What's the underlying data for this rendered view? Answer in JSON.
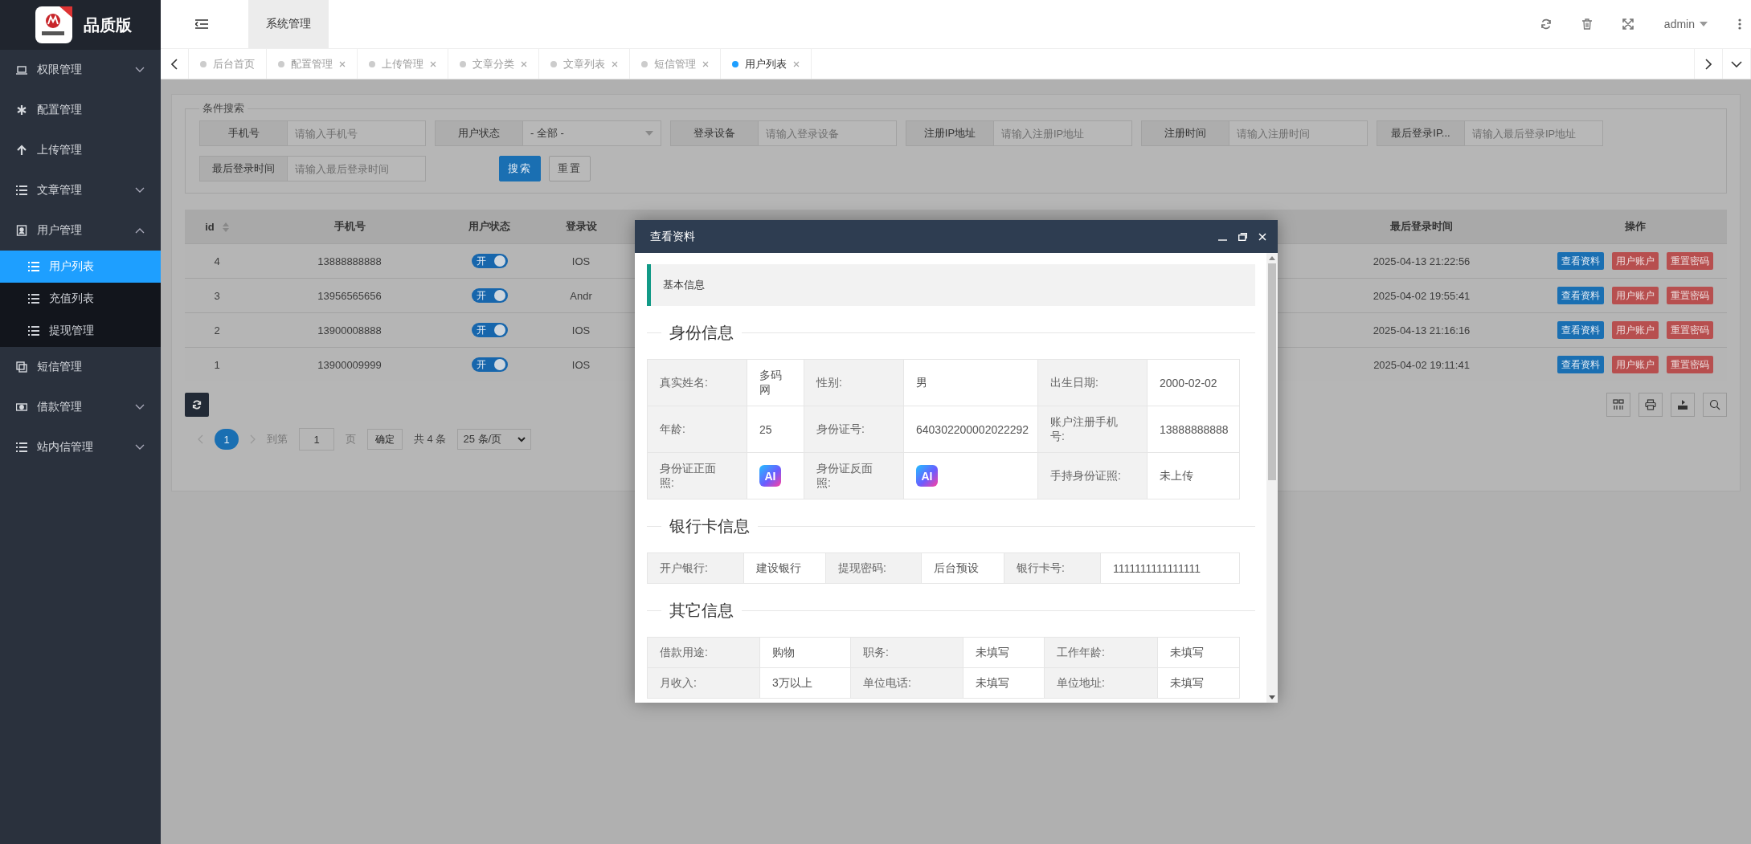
{
  "sidebar": {
    "brand": "品质版",
    "menu": [
      {
        "label": "权限管理",
        "expanded": false
      },
      {
        "label": "配置管理"
      },
      {
        "label": "上传管理"
      },
      {
        "label": "文章管理",
        "expanded": false
      },
      {
        "label": "用户管理",
        "expanded": true,
        "children": [
          {
            "label": "用户列表",
            "selected": true
          },
          {
            "label": "充值列表",
            "selected": false
          },
          {
            "label": "提现管理",
            "selected": false
          }
        ]
      },
      {
        "label": "短信管理"
      },
      {
        "label": "借款管理",
        "expanded": false
      },
      {
        "label": "站内信管理",
        "expanded": false
      }
    ]
  },
  "topbar": {
    "module_tab": "系统管理",
    "user": "admin"
  },
  "tabs": [
    {
      "label": "后台首页",
      "closable": false,
      "selected": false
    },
    {
      "label": "配置管理",
      "closable": true,
      "selected": false
    },
    {
      "label": "上传管理",
      "closable": true,
      "selected": false
    },
    {
      "label": "文章分类",
      "closable": true,
      "selected": false
    },
    {
      "label": "文章列表",
      "closable": true,
      "selected": false
    },
    {
      "label": "短信管理",
      "closable": true,
      "selected": false
    },
    {
      "label": "用户列表",
      "closable": true,
      "selected": true
    }
  ],
  "search": {
    "legend": "条件搜索",
    "fields": [
      {
        "label": "手机号",
        "kind": "input",
        "placeholder": "请输入手机号"
      },
      {
        "label": "用户状态",
        "kind": "select",
        "value": "- 全部 -"
      },
      {
        "label": "登录设备",
        "kind": "input",
        "placeholder": "请输入登录设备"
      },
      {
        "label": "注册IP地址",
        "kind": "input",
        "placeholder": "请输入注册IP地址"
      },
      {
        "label": "注册时间",
        "kind": "input",
        "placeholder": "请输入注册时间"
      },
      {
        "label": "最后登录IP...",
        "kind": "input",
        "placeholder": "请输入最后登录IP地址"
      },
      {
        "label": "最后登录时间",
        "kind": "input",
        "placeholder": "请输入最后登录时间"
      }
    ],
    "buttons": [
      {
        "label": "搜索",
        "kind": "primary"
      },
      {
        "label": "重置",
        "kind": "default"
      }
    ]
  },
  "table": {
    "columns": [
      {
        "label": "id",
        "sortable": true
      },
      {
        "label": "手机号",
        "sortable": false
      },
      {
        "label": "用户状态",
        "sortable": false
      },
      {
        "label": "登录设",
        "sortable": false
      },
      {
        "label": "最后登录时间",
        "sortable": false
      },
      {
        "label": "操作",
        "sortable": false
      }
    ],
    "rows": [
      {
        "id": "4",
        "phone": "13888888888",
        "status": {
          "label": "开",
          "on": true
        },
        "device": "IOS",
        "last_login": "2025-04-13 21:22:56",
        "actions": [
          {
            "label": "查看资料",
            "kind": "primary"
          },
          {
            "label": "用户账户",
            "kind": "danger"
          },
          {
            "label": "重置密码",
            "kind": "danger"
          }
        ]
      },
      {
        "id": "3",
        "phone": "13956565656",
        "status": {
          "label": "开",
          "on": true
        },
        "device": "Andr",
        "last_login": "2025-04-02 19:55:41",
        "actions": [
          {
            "label": "查看资料",
            "kind": "primary"
          },
          {
            "label": "用户账户",
            "kind": "danger"
          },
          {
            "label": "重置密码",
            "kind": "danger"
          }
        ]
      },
      {
        "id": "2",
        "phone": "13900008888",
        "status": {
          "label": "开",
          "on": true
        },
        "device": "IOS",
        "last_login": "2025-04-13 21:16:16",
        "actions": [
          {
            "label": "查看资料",
            "kind": "primary"
          },
          {
            "label": "用户账户",
            "kind": "danger"
          },
          {
            "label": "重置密码",
            "kind": "danger"
          }
        ]
      },
      {
        "id": "1",
        "phone": "13900009999",
        "status": {
          "label": "开",
          "on": true
        },
        "device": "IOS",
        "last_login": "2025-04-02 19:11:41",
        "actions": [
          {
            "label": "查看资料",
            "kind": "primary"
          },
          {
            "label": "用户账户",
            "kind": "danger"
          },
          {
            "label": "重置密码",
            "kind": "danger"
          }
        ]
      }
    ]
  },
  "pagination": {
    "pages": [
      {
        "label": "1",
        "selected": true
      }
    ],
    "goto_label": "到第",
    "page_input": "1",
    "page_unit": "页",
    "confirm": "确定",
    "total": "共 4 条",
    "page_size": "25 条/页"
  },
  "modal": {
    "title": "查看资料",
    "note": "基本信息",
    "sections": [
      {
        "title": "身份信息",
        "rows": [
          [
            {
              "label": "真实姓名:",
              "value": "多码网",
              "kind": "text"
            },
            {
              "label": "性别:",
              "value": "男",
              "kind": "text"
            },
            {
              "label": "出生日期:",
              "value": "2000-02-02",
              "kind": "text"
            }
          ],
          [
            {
              "label": "年龄:",
              "value": "25",
              "kind": "text"
            },
            {
              "label": "身份证号:",
              "value": "640302200002022292",
              "kind": "text"
            },
            {
              "label": "账户注册手机号:",
              "value": "13888888888",
              "kind": "text"
            }
          ],
          [
            {
              "label": "身份证正面照:",
              "value": "AI",
              "kind": "image"
            },
            {
              "label": "身份证反面照:",
              "value": "AI",
              "kind": "image"
            },
            {
              "label": "手持身份证照:",
              "value": "未上传",
              "kind": "text"
            }
          ]
        ]
      },
      {
        "title": "银行卡信息",
        "rows": [
          [
            {
              "label": "开户银行:",
              "value": "建设银行",
              "kind": "text"
            },
            {
              "label": "提现密码:",
              "value": "后台预设",
              "kind": "text"
            },
            {
              "label": "银行卡号:",
              "value": "1111111111111111",
              "kind": "text"
            }
          ]
        ]
      },
      {
        "title": "其它信息",
        "rows": [
          [
            {
              "label": "借款用途:",
              "value": "购物",
              "kind": "text"
            },
            {
              "label": "职务:",
              "value": "未填写",
              "kind": "text"
            },
            {
              "label": "工作年龄:",
              "value": "未填写",
              "kind": "text"
            }
          ],
          [
            {
              "label": "月收入:",
              "value": "3万以上",
              "kind": "text"
            },
            {
              "label": "单位电话:",
              "value": "未填写",
              "kind": "text"
            },
            {
              "label": "单位地址:",
              "value": "未填写",
              "kind": "text"
            }
          ]
        ]
      }
    ]
  }
}
